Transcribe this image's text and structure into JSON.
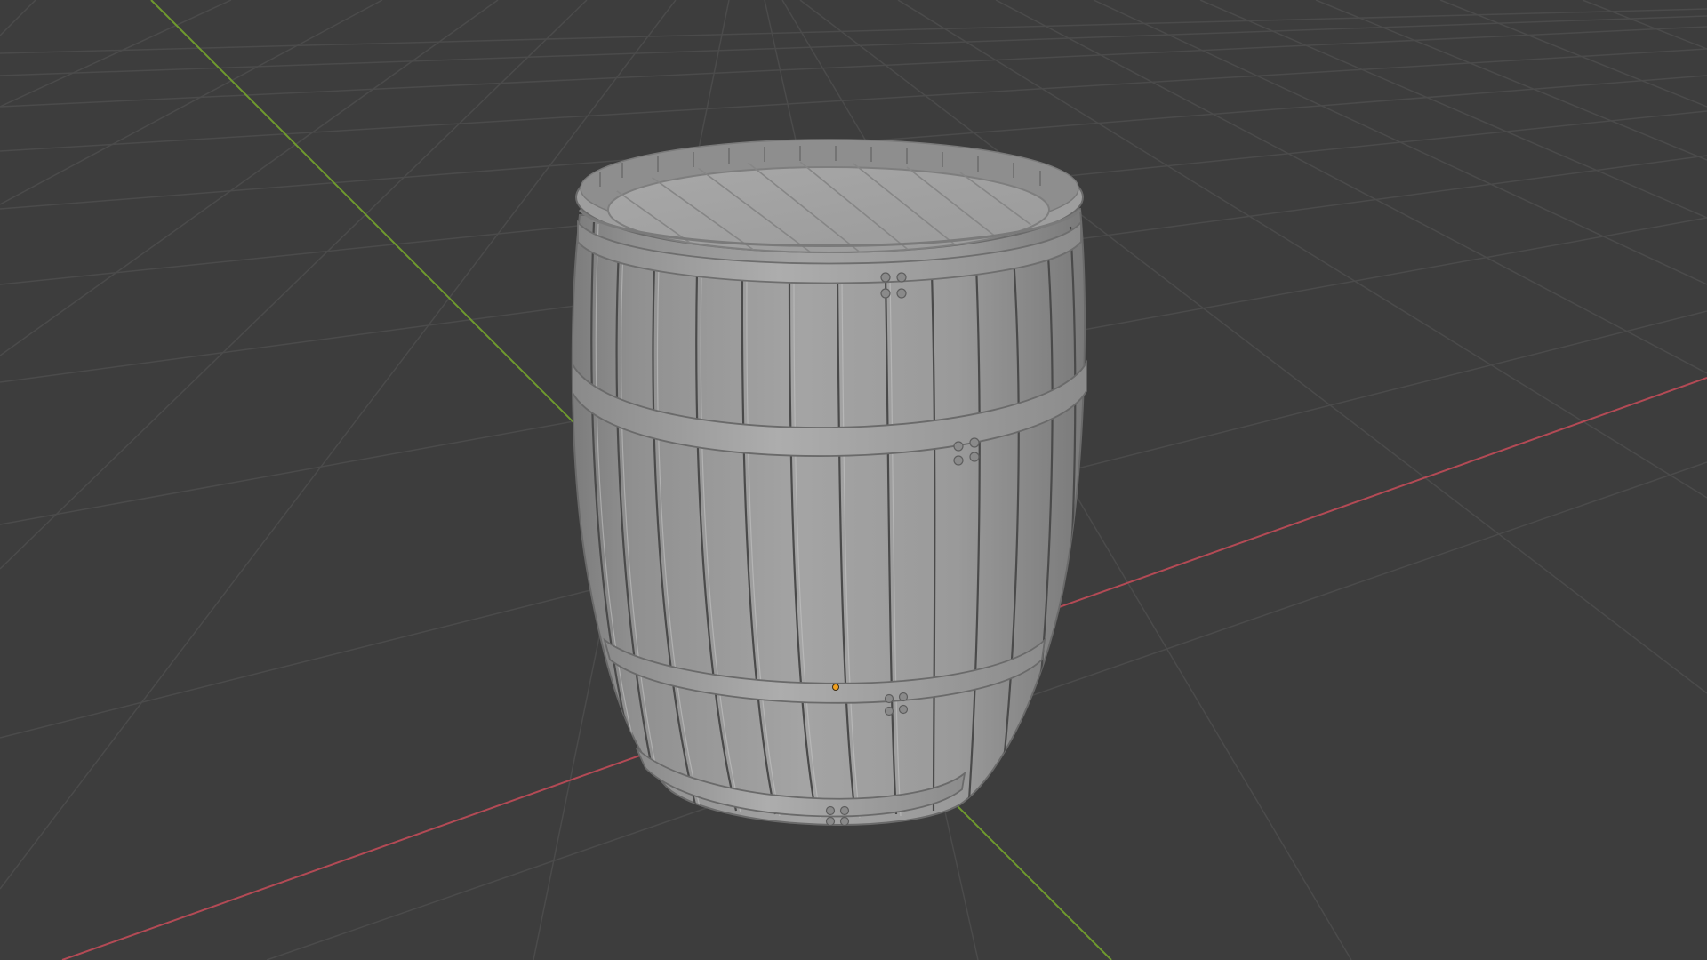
{
  "viewport": {
    "background": "#3d3d3d",
    "grid_color": "#4a4a4a",
    "x_axis_color": "#b34a55",
    "y_axis_color": "#6f9a2e",
    "origin_color": "#f0a020"
  },
  "object": {
    "name": "barrel",
    "shading": "solid",
    "base_color": "#9c9c9c",
    "shadow_color": "#6e6e6e",
    "highlight_color": "#b8b8b8",
    "hoop_color": "#a2a2a2"
  },
  "icons": {
    "origin": "object-origin-icon"
  }
}
